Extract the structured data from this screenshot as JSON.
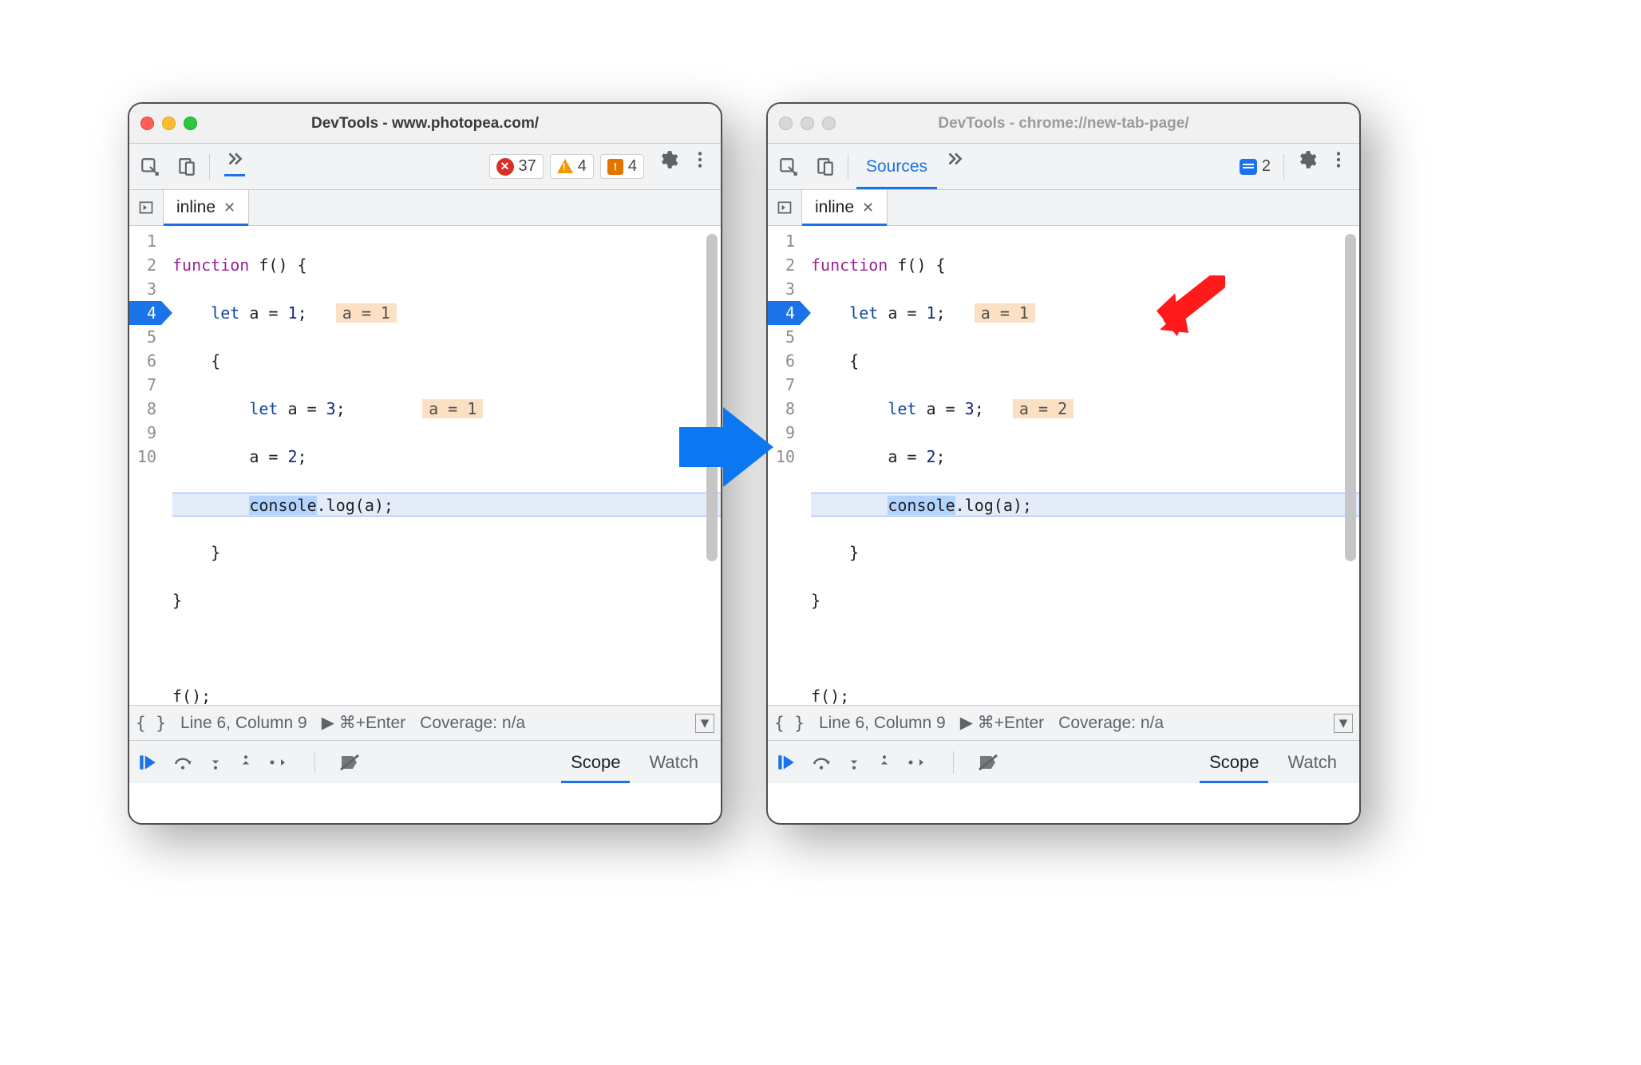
{
  "left": {
    "title": "DevTools - www.photopea.com/",
    "active_window": true,
    "counts": {
      "errors": "37",
      "warnings": "4",
      "issues": "4"
    },
    "filetab": "inline",
    "lines": [
      "1",
      "2",
      "3",
      "4",
      "5",
      "6",
      "7",
      "8",
      "9",
      "10"
    ],
    "exec_line": 4,
    "hint2": "a = 1",
    "hint4": "a = 1",
    "code": {
      "l1a": "function",
      "l1b": " f() {",
      "l2a": "let",
      "l2b": " a = ",
      "l2c": "1",
      "l2d": ";",
      "l3": "{",
      "l4a": "let",
      "l4b": " a = ",
      "l4c": "3",
      "l4d": ";",
      "l5a": "a = ",
      "l5b": "2",
      "l5c": ";",
      "l6a": "console",
      "l6b": ".log(a);",
      "l7": "}",
      "l8": "}",
      "l10": "f();"
    },
    "status": {
      "pos": "Line 6, Column 9",
      "run": "⌘+Enter",
      "cov": "Coverage: n/a"
    },
    "tabs": {
      "scope": "Scope",
      "watch": "Watch"
    }
  },
  "right": {
    "title": "DevTools - chrome://new-tab-page/",
    "active_window": false,
    "sources_label": "Sources",
    "msg_count": "2",
    "filetab": "inline",
    "lines": [
      "1",
      "2",
      "3",
      "4",
      "5",
      "6",
      "7",
      "8",
      "9",
      "10"
    ],
    "exec_line": 4,
    "hint2": "a = 1",
    "hint4": "a = 2",
    "code": {
      "l1a": "function",
      "l1b": " f() {",
      "l2a": "let",
      "l2b": " a = ",
      "l2c": "1",
      "l2d": ";",
      "l3": "{",
      "l4a": "let",
      "l4b": " a = ",
      "l4c": "3",
      "l4d": ";",
      "l5a": "a = ",
      "l5b": "2",
      "l5c": ";",
      "l6a": "console",
      "l6b": ".log(a);",
      "l7": "}",
      "l8": "}",
      "l10": "f();"
    },
    "status": {
      "pos": "Line 6, Column 9",
      "run": "⌘+Enter",
      "cov": "Coverage: n/a"
    },
    "tabs": {
      "scope": "Scope",
      "watch": "Watch"
    }
  },
  "labels": {
    "play": "▶",
    "braces": "{ }"
  }
}
